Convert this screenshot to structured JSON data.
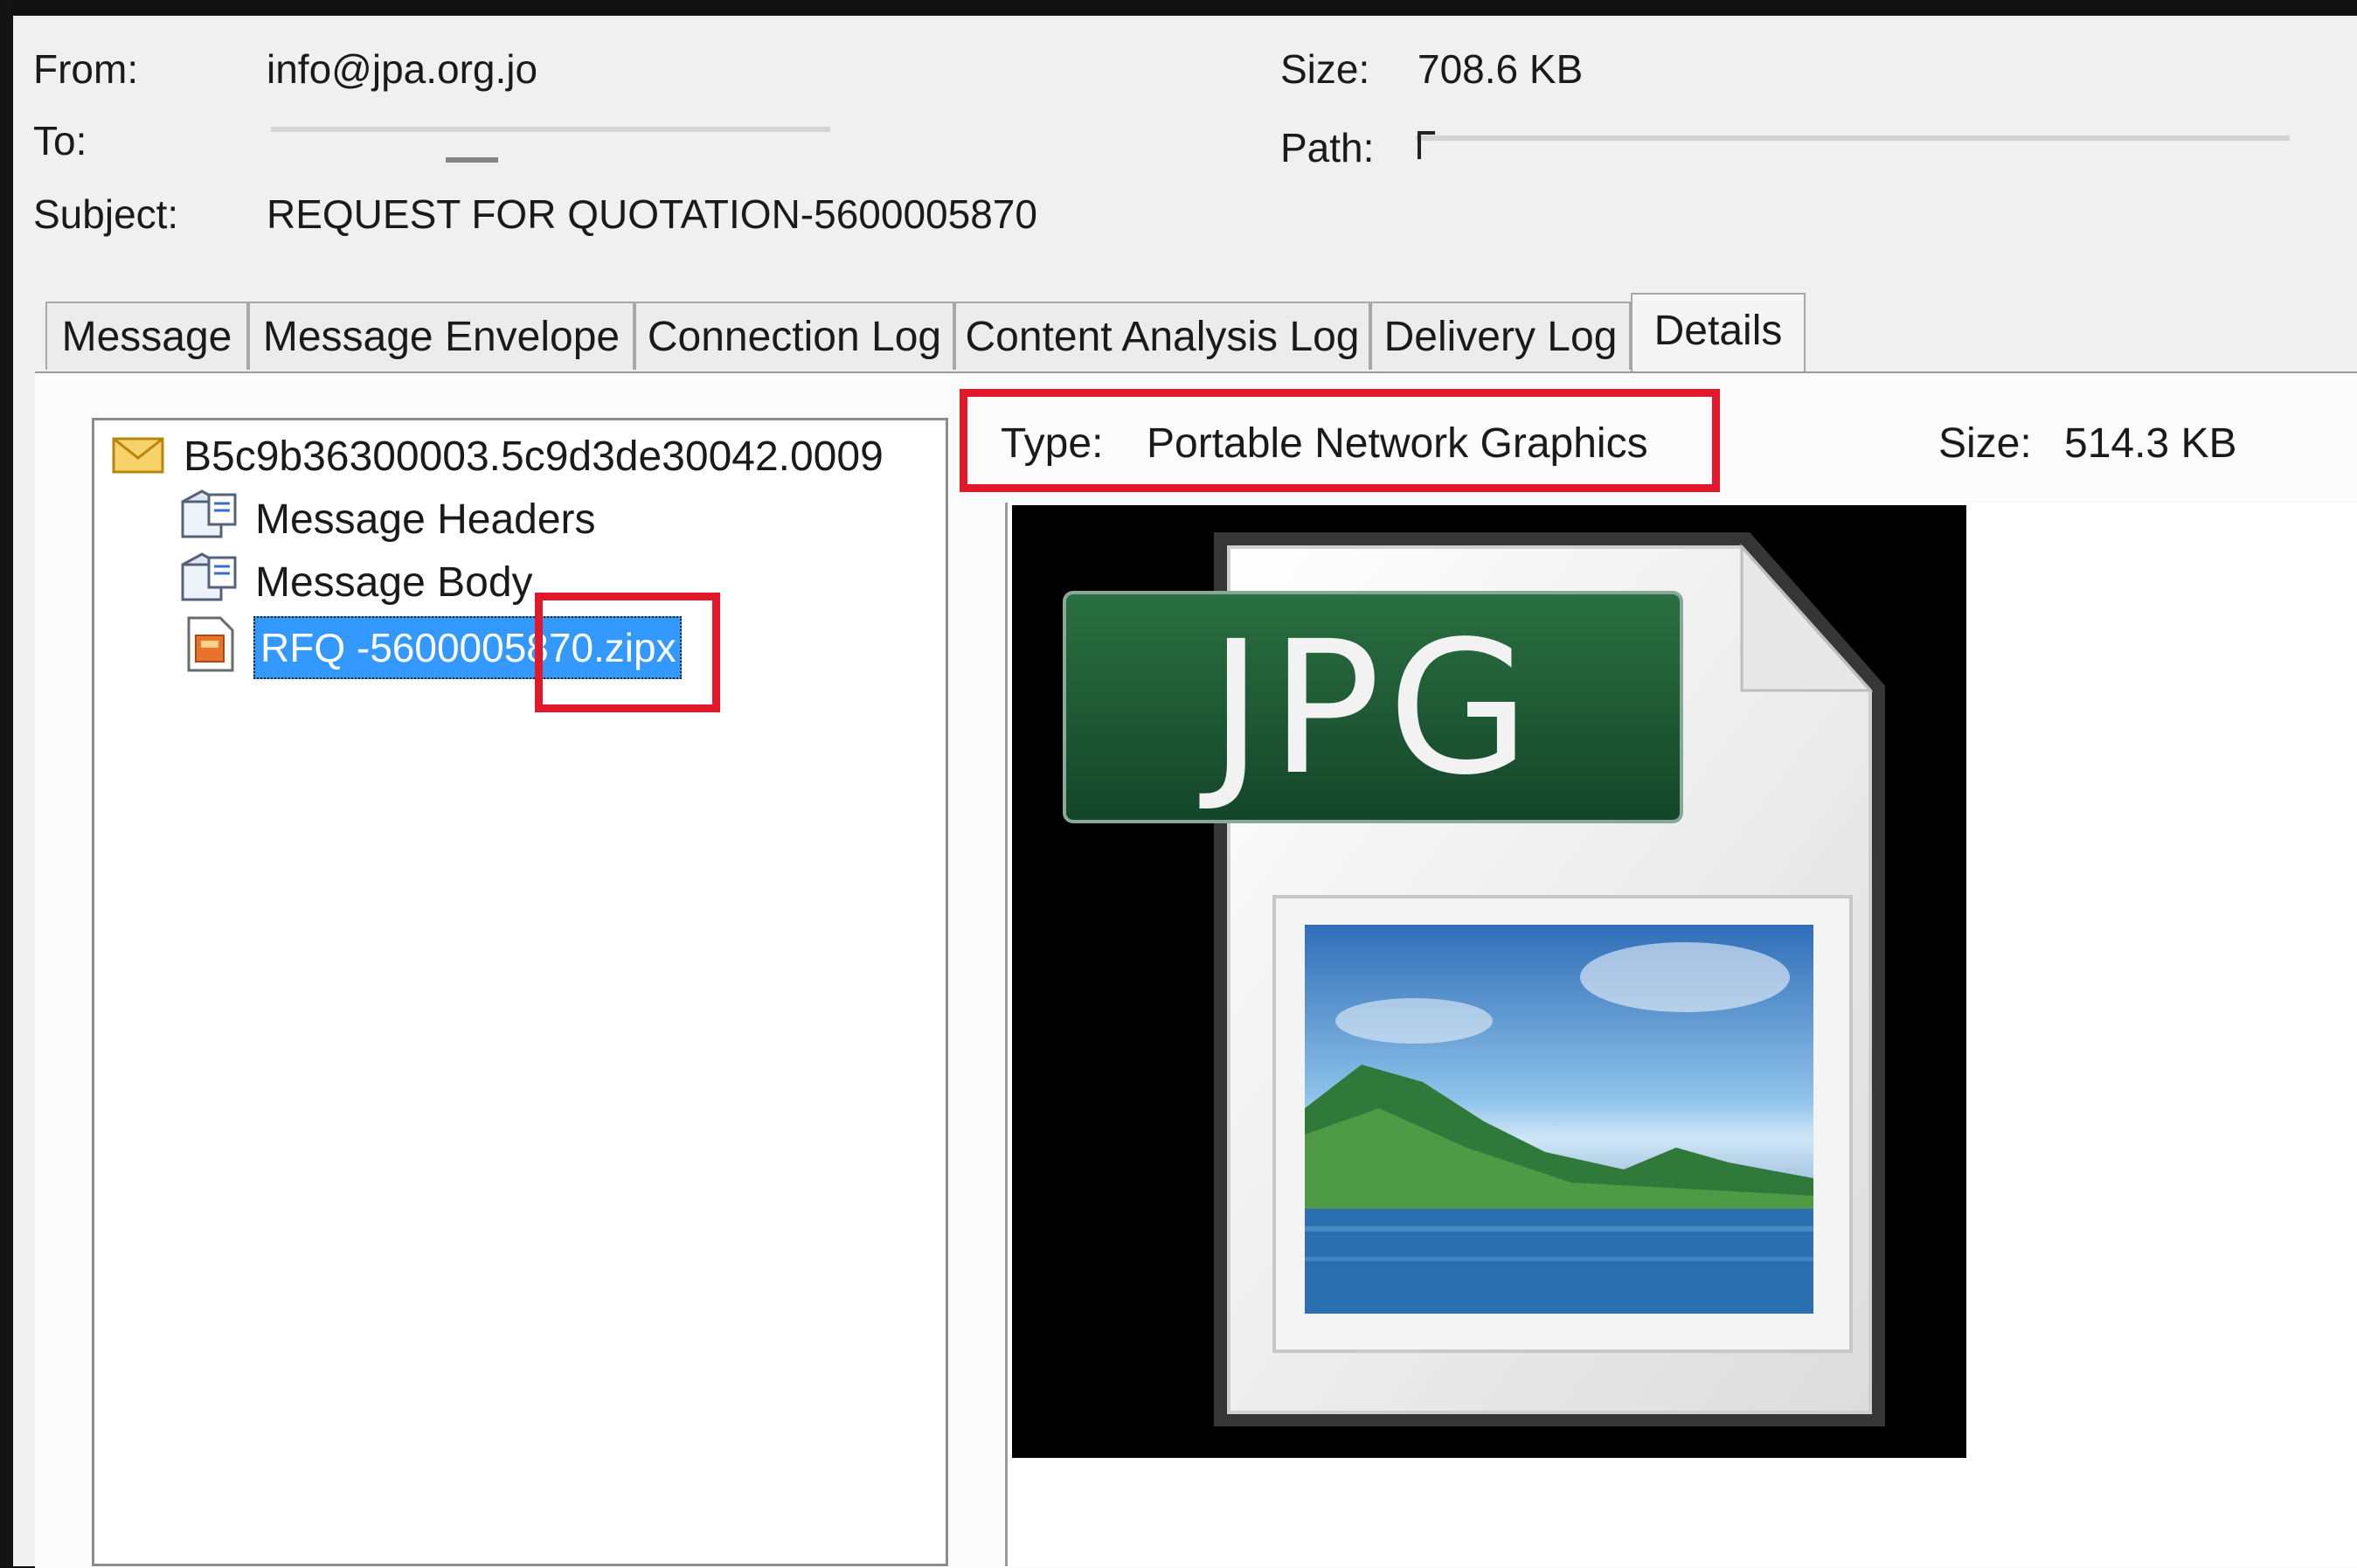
{
  "header": {
    "from_label": "From:",
    "from_value": "info@jpa.org.jo",
    "to_label": "To:",
    "subject_label": "Subject:",
    "subject_value": "REQUEST FOR QUOTATION-5600005870",
    "size_label": "Size:",
    "size_value": "708.6 KB",
    "path_label": "Path:"
  },
  "tabs": [
    {
      "label": "Message",
      "active": false
    },
    {
      "label": "Message Envelope",
      "active": false
    },
    {
      "label": "Connection Log",
      "active": false
    },
    {
      "label": "Content Analysis Log",
      "active": false
    },
    {
      "label": "Delivery Log",
      "active": false
    },
    {
      "label": "Details",
      "active": true
    }
  ],
  "tree": {
    "root": "B5c9b36300003.5c9d3de30042.0009",
    "items": [
      "Message Headers",
      "Message Body"
    ],
    "selected_item": "RFQ -5600005870.zipx"
  },
  "details": {
    "type_label": "Type:",
    "type_value": "Portable Network Graphics",
    "size_label": "Size:",
    "size_value": "514.3 KB",
    "preview_badge": "JPG"
  },
  "colors": {
    "highlight_red": "#e2172a",
    "selection_blue": "#3399ff",
    "badge_green": "#1f5a33"
  }
}
